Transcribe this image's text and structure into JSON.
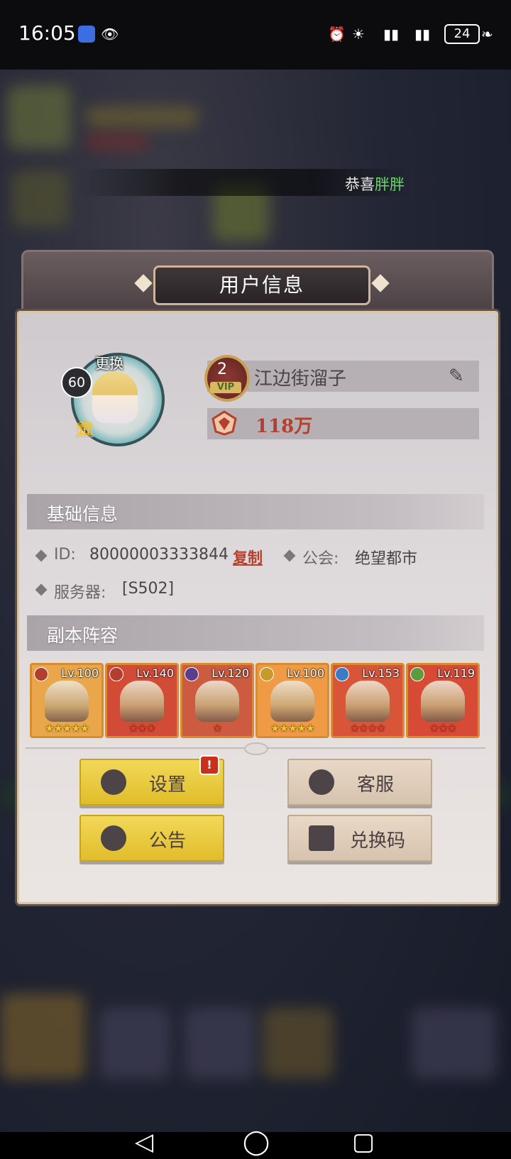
{
  "status_bar": {
    "time": "16:05",
    "battery": "24",
    "icons": [
      "app-icon",
      "eye-icon",
      "alarm-icon",
      "wifi-icon",
      "signal-icon",
      "signal-icon",
      "battery-icon",
      "leaf-icon"
    ]
  },
  "broadcast": {
    "prefix": "恭喜",
    "name": "胖胖"
  },
  "dialog": {
    "title": "用户信息",
    "profile": {
      "level": "60",
      "change_label": "更换",
      "vip_level": "2",
      "vip_label": "VIP",
      "name": "江边街溜子",
      "power": "118万"
    },
    "basic_info": {
      "title": "基础信息",
      "id_label": "ID:",
      "id_value": "80000003333844",
      "copy_label": "复制",
      "guild_label": "公会:",
      "guild_value": "绝望都市",
      "server_label": "服务器:",
      "server_value": "[S502]"
    },
    "lineup": {
      "title": "副本阵容",
      "heroes": [
        {
          "level": "Lv.100",
          "stars": "★★★★★",
          "star_color": "#f5c531",
          "bg": "#e9a64a",
          "element_color": "#b33d2e"
        },
        {
          "level": "Lv.140",
          "stars": "★★★",
          "star_color": "#e0402b",
          "bg": "#d24b36",
          "element_color": "#b33d2e"
        },
        {
          "level": "Lv.120",
          "stars": "★",
          "star_color": "#e0402b",
          "bg": "#cc5b3f",
          "element_color": "#5a3d8c"
        },
        {
          "level": "Lv.100",
          "stars": "★★★★★",
          "star_color": "#f5c531",
          "bg": "#ef9a45",
          "element_color": "#c79a2c"
        },
        {
          "level": "Lv.153",
          "stars": "★★★★",
          "star_color": "#e0402b",
          "bg": "#d9553a",
          "element_color": "#3a7bc8"
        },
        {
          "level": "Lv.119",
          "stars": "★★★",
          "star_color": "#e0402b",
          "bg": "#d64a36",
          "element_color": "#5b9b3a"
        }
      ]
    },
    "buttons": {
      "settings": "设置",
      "service": "客服",
      "notice": "公告",
      "redeem": "兑换码",
      "alert": "!"
    }
  }
}
